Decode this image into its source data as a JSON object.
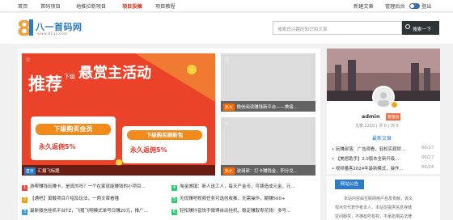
{
  "topnav": {
    "items": [
      "首页",
      "首码项目",
      "地推拉新项目",
      "项目投稿",
      "项目教程"
    ],
    "active_index": 3,
    "right": {
      "new_article": "新建文章",
      "admin_panel": "管理后台",
      "logout": "登出"
    }
  },
  "header": {
    "logo_text": "八一首码网",
    "logo_sub": "www.81qs.com",
    "search_placeholder": "搜索您兴趣的知识和文章",
    "search_button": "搜索一下"
  },
  "banner": {
    "title_big": "推荐",
    "title_small": "下级",
    "title_main": "悬赏主活动",
    "left_card_line1": "下级购买会员",
    "left_card_line2": "永久返佣5%",
    "right_card_line1": "下级购买刷新包",
    "right_card_line2": "永久返佣5%",
    "caption_tag": "首页",
    "caption_text": "汇捐飞标题"
  },
  "minis": [
    {
      "tag": "热文",
      "text": "微信阅读赚钱新平台——美接..."
    },
    {
      "tag": "热文",
      "text": "波澜部：打卡赚钱金，积分兑..."
    }
  ],
  "list": [
    {
      "num": "1",
      "color": "#e84c3d",
      "text": "游帮赚钱玩赚卡，是真的吗？一个在家就能赚钱的小项目..."
    },
    {
      "num": "2",
      "color": "#f39c12",
      "text": "【通吧】寅酸项目介绍及玩法，一两文章看懂"
    },
    {
      "num": "3",
      "color": "#3a9ad9",
      "text": "最新微信挂机平台TZ，飞猪飞翔模式单号日赚20元，推广..."
    },
    {
      "num": "4",
      "color": "#2ecc71",
      "text": "淘金城镇：新人送工人，每天产金币，可铸造成元金，元..."
    },
    {
      "num": "5",
      "color": "#2ecc71",
      "text": "无优赚吧视频任务可选创收推，无需操作，躺赚500+"
    },
    {
      "num": "6",
      "color": "#2ecc71",
      "text": "轻松赚抖音快手微博自动挂机，稳定赚取零花钱！多号..."
    }
  ],
  "profile": {
    "name": "admin",
    "badge": "管理员",
    "stats": "文章 2210 | 评 0 | 浏 0",
    "latest_title": "最新文章"
  },
  "sidebar_list": [
    {
      "text": "玩赚部落：广告观看，轻松实现财...",
      "date": "06/27"
    },
    {
      "text": "【美居助手】2.0版本全新升级...",
      "date": "06/27"
    },
    {
      "text": "视频番客2024年最新模式，操作...",
      "date": "06/26"
    }
  ],
  "notice": {
    "tab": "网站公告",
    "line1": "本站内容由互联网用户自发贡献，该文",
    "line2": "观点仅代表作者本人。本站仅提供信息存储",
    "line3": "空间服务，不拥有所有权，不承担相关法律"
  },
  "colors": {
    "accent": "#2b7bc8",
    "active_nav": "#d0341d",
    "banner_red": "#d8281b",
    "orange": "#ff8c1a"
  }
}
